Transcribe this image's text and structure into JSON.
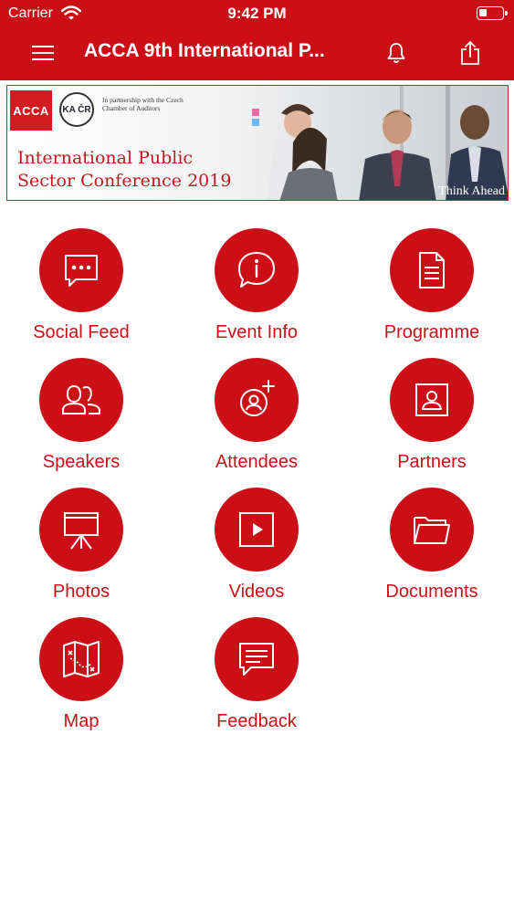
{
  "status_bar": {
    "carrier": "Carrier",
    "time": "9:42 PM"
  },
  "navbar": {
    "title": "ACCA 9th International P..."
  },
  "banner": {
    "acca_logo": "ACCA",
    "partner_logo": "KA ČR",
    "partner_text": "In partnership with the Czech Chamber of Auditors",
    "title_line1": "International Public",
    "title_line2": "Sector Conference 2019",
    "tagline": "Think Ahead"
  },
  "tiles": [
    {
      "label": "Social Feed",
      "icon": "chat-bubble-icon"
    },
    {
      "label": "Event Info",
      "icon": "info-icon"
    },
    {
      "label": "Programme",
      "icon": "document-icon"
    },
    {
      "label": "Speakers",
      "icon": "people-icon"
    },
    {
      "label": "Attendees",
      "icon": "add-person-icon"
    },
    {
      "label": "Partners",
      "icon": "contact-card-icon"
    },
    {
      "label": "Photos",
      "icon": "easel-icon"
    },
    {
      "label": "Videos",
      "icon": "play-icon"
    },
    {
      "label": "Documents",
      "icon": "folder-icon"
    },
    {
      "label": "Map",
      "icon": "map-icon"
    },
    {
      "label": "Feedback",
      "icon": "feedback-icon"
    }
  ],
  "colors": {
    "brand_red": "#cc0f16",
    "background": "#ffffff"
  }
}
